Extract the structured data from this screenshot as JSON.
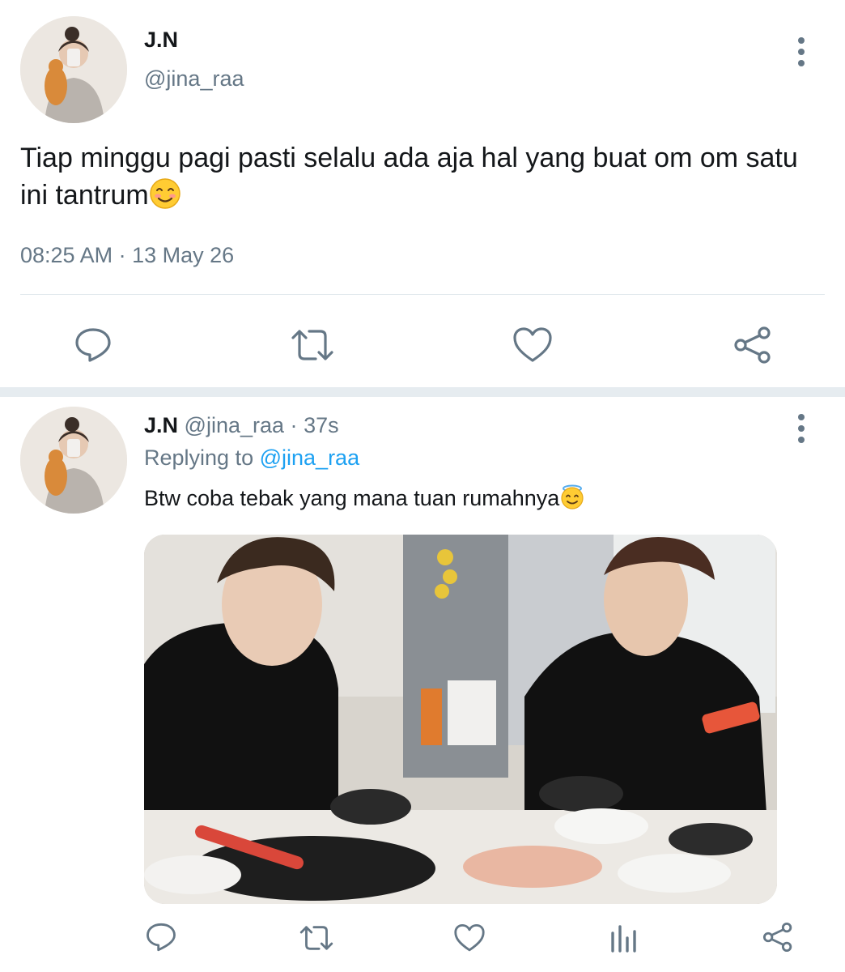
{
  "main_tweet": {
    "display_name": "J.N",
    "handle": "@jina_raa",
    "text": "Tiap minggu pagi pasti selalu ada aja hal yang buat om om satu ini tantrum",
    "text_emoji": "smiling-face-icon",
    "time": "08:25 AM",
    "dot": "·",
    "date": "13 May 26"
  },
  "reply_tweet": {
    "display_name": "J.N",
    "handle": "@jina_raa",
    "dot": "·",
    "age": "37s",
    "replying_prefix": "Replying to",
    "replying_handle": "@jina_raa",
    "text": "Btw coba tebak yang mana tuan rumahnya",
    "text_emoji": "smiling-face-with-halo-icon"
  },
  "action_icons": {
    "main": [
      "reply-icon",
      "retweet-icon",
      "like-icon",
      "share-icon"
    ],
    "reply": [
      "reply-icon",
      "retweet-icon",
      "like-icon",
      "analytics-icon",
      "share-icon"
    ]
  },
  "colors": {
    "text": "#14171a",
    "secondary": "#657786",
    "link": "#1da1f2",
    "divider": "#e1e8ed"
  }
}
